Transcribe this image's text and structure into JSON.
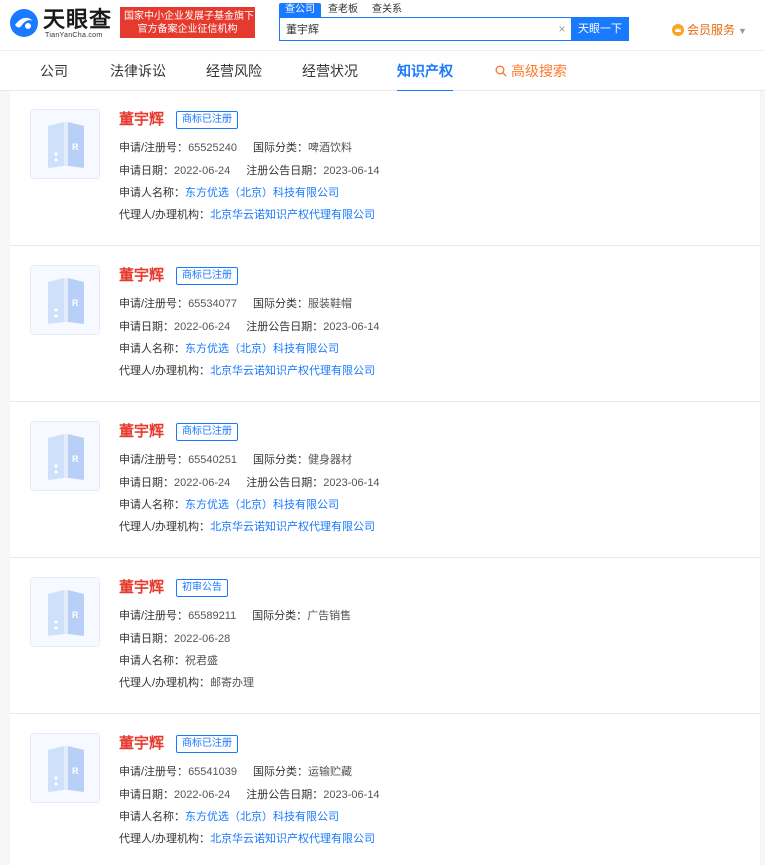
{
  "brand": {
    "name": "天眼查",
    "domain": "TianYanCha.com",
    "badge_line1": "国家中小企业发展子基金旗下",
    "badge_line2": "官方备案企业征信机构"
  },
  "search": {
    "tabs": [
      "查公司",
      "查老板",
      "查关系"
    ],
    "value": "董宇辉",
    "button": "天眼一下"
  },
  "vip": {
    "label": "会员服务"
  },
  "nav": {
    "items": [
      "公司",
      "法律诉讼",
      "经营风险",
      "经营状况",
      "知识产权"
    ],
    "advanced": "高级搜索"
  },
  "labels": {
    "reg_no": "申请/注册号：",
    "intl_class": "国际分类：",
    "apply_date": "申请日期：",
    "announce_date": "注册公告日期：",
    "applicant": "申请人名称：",
    "agent": "代理人/办理机构："
  },
  "cards": [
    {
      "name": "董宇辉",
      "status": "商标已注册",
      "reg_no": "65525240",
      "intl_class": "啤酒饮料",
      "apply_date": "2022-06-24",
      "announce_date": "2023-06-14",
      "applicant": "东方优选（北京）科技有限公司",
      "agent": "北京华云诺知识产权代理有限公司"
    },
    {
      "name": "董宇辉",
      "status": "商标已注册",
      "reg_no": "65534077",
      "intl_class": "服装鞋帽",
      "apply_date": "2022-06-24",
      "announce_date": "2023-06-14",
      "applicant": "东方优选（北京）科技有限公司",
      "agent": "北京华云诺知识产权代理有限公司"
    },
    {
      "name": "董宇辉",
      "status": "商标已注册",
      "reg_no": "65540251",
      "intl_class": "健身器材",
      "apply_date": "2022-06-24",
      "announce_date": "2023-06-14",
      "applicant": "东方优选（北京）科技有限公司",
      "agent": "北京华云诺知识产权代理有限公司"
    },
    {
      "name": "董宇辉",
      "status": "初审公告",
      "reg_no": "65589211",
      "intl_class": "广告销售",
      "apply_date": "2022-06-28",
      "announce_date": "",
      "applicant": "祝君盛",
      "agent": "邮寄办理"
    },
    {
      "name": "董宇辉",
      "status": "商标已注册",
      "reg_no": "65541039",
      "intl_class": "运输贮藏",
      "apply_date": "2022-06-24",
      "announce_date": "2023-06-14",
      "applicant": "东方优选（北京）科技有限公司",
      "agent": "北京华云诺知识产权代理有限公司"
    }
  ],
  "colors": {
    "accent": "#1979ff",
    "name_red": "#e63a2e",
    "vip_orange": "#e86a0c",
    "advanced_orange": "#ff7a2c"
  }
}
